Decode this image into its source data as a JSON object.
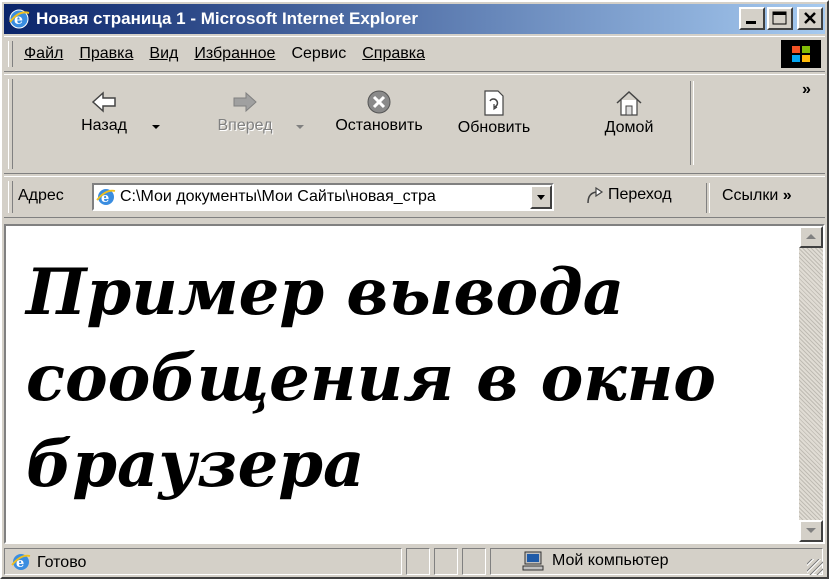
{
  "window": {
    "title": "Новая страница 1 - Microsoft Internet Explorer"
  },
  "menu": {
    "items": [
      "Файл",
      "Правка",
      "Вид",
      "Избранное",
      "Сервис",
      "Справка"
    ]
  },
  "toolbar": {
    "back_label": "Назад",
    "forward_label": "Вперед",
    "stop_label": "Остановить",
    "refresh_label": "Обновить",
    "home_label": "Домой",
    "more": "»"
  },
  "address": {
    "label": "Адрес",
    "value": "C:\\Мои документы\\Мои Сайты\\новая_стра",
    "go_label": "Переход",
    "links_label": "Ссылки"
  },
  "page": {
    "heading": "Пример вывода сообщения в окно браузера"
  },
  "status": {
    "text": "Готово",
    "zone": "Мой компьютер"
  },
  "colors": {
    "titlebar_start": "#0a246a",
    "titlebar_end": "#a6caf0",
    "chrome": "#d4d0c8"
  }
}
